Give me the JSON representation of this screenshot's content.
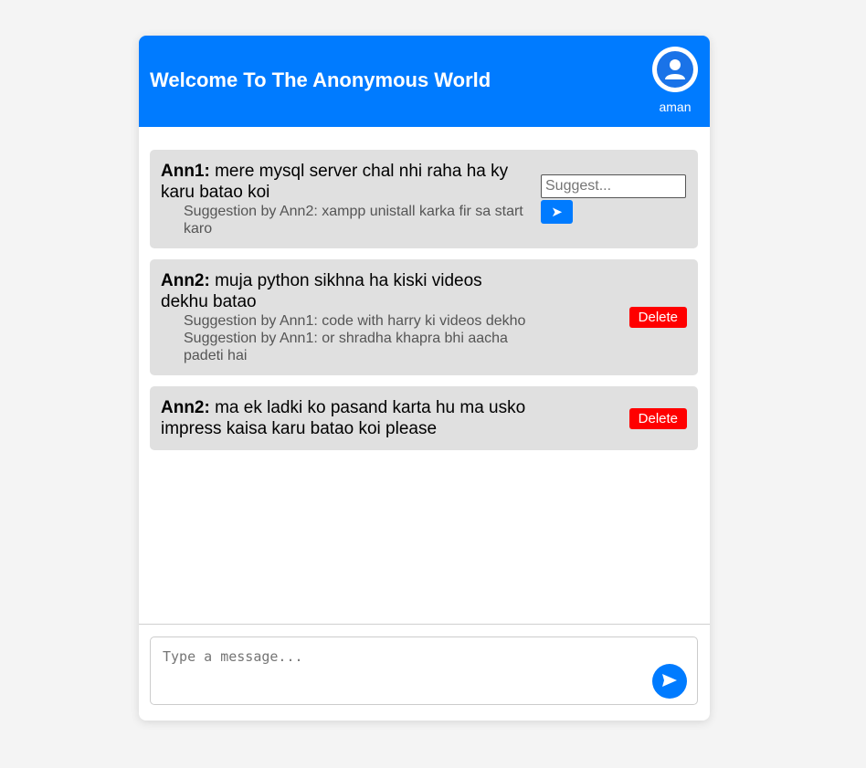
{
  "header": {
    "title": "Welcome To The Anonymous World",
    "username": "aman",
    "avatar_icon": "user-icon"
  },
  "messages": [
    {
      "author": "Ann1:",
      "text": "mere mysql server chal nhi raha ha ky karu batao koi",
      "suggestions": [
        "Suggestion by Ann2: xampp unistall karka fir sa start karo"
      ],
      "suggest_placeholder": "Suggest...",
      "suggest_send_icon": "send-arrow-icon"
    },
    {
      "author": "Ann2:",
      "text": "muja python sikhna ha kiski videos dekhu batao",
      "suggestions": [
        "Suggestion by Ann1: code with harry ki videos dekho",
        "Suggestion by Ann1: or shradha khapra bhi aacha padeti hai"
      ],
      "delete_label": "Delete"
    },
    {
      "author": "Ann2:",
      "text": "ma ek ladki ko pasand karta hu ma usko impress kaisa karu batao koi please",
      "suggestions": [],
      "delete_label": "Delete"
    }
  ],
  "composer": {
    "placeholder": "Type a message...",
    "send_icon": "send-icon"
  },
  "colors": {
    "accent": "#007bff",
    "delete": "#ff0000",
    "message_bg": "#e0e0e0",
    "page_bg": "#f4f4f4"
  }
}
